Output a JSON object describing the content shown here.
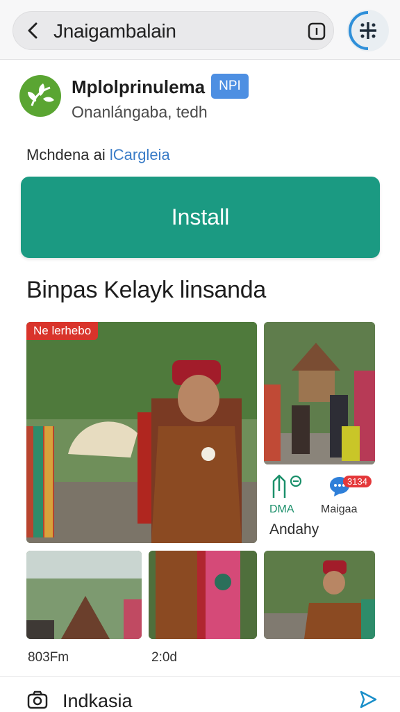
{
  "topbar": {
    "search_text": "Jnaigambalain",
    "back_icon": "back-arrow-icon",
    "tab_icon": "tab-count-icon",
    "menu_icon": "grid-plus-icon"
  },
  "app": {
    "name": "Mplolprinulema",
    "badge": "NPI",
    "developer": "Onanlángaba, tedh",
    "icon": "leaf-icon",
    "icon_color": "#5aa532"
  },
  "contains": {
    "prefix": "Mchdena ai ",
    "link": "lCargleia"
  },
  "install": {
    "label": "Install",
    "color": "#1b9a82"
  },
  "section": {
    "title": "Binpas Kelayk linsanda"
  },
  "gallery": {
    "main_tag": "Ne lerhebo",
    "stat1_label": "DMA",
    "stat1_icon": "hand-shield-icon",
    "stat2_icon": "chat-bubble-icon",
    "stat2_badge": "3134",
    "stat2_label": "Maigaa",
    "stat_caption": "Andahy",
    "caption1": "803Fm",
    "caption2": "2:0d"
  },
  "bottombar": {
    "label": "Indkasia",
    "camera_icon": "camera-icon",
    "send_icon": "send-icon"
  }
}
